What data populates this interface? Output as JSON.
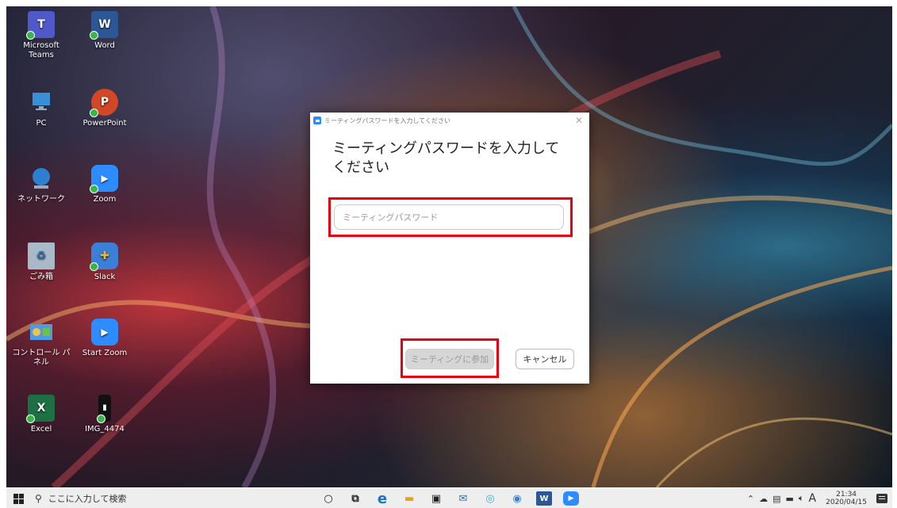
{
  "desktop_icons": [
    {
      "label": "Microsoft Teams",
      "glyph": "T",
      "color": "#5059c9",
      "icon": "teams-icon"
    },
    {
      "label": "Word",
      "glyph": "W",
      "color": "#2b5797",
      "icon": "word-icon"
    },
    {
      "label": "PC",
      "glyph": "",
      "color": "#3a8fd9",
      "icon": "pc-icon"
    },
    {
      "label": "PowerPoint",
      "glyph": "P",
      "color": "#d24726",
      "icon": "powerpoint-icon"
    },
    {
      "label": "ネットワーク",
      "glyph": "",
      "color": "#2f7fd1",
      "icon": "network-icon"
    },
    {
      "label": "Zoom",
      "glyph": "▶",
      "color": "#2d8cff",
      "icon": "zoom-icon"
    },
    {
      "label": "ごみ箱",
      "glyph": "♻",
      "color": "#a8b9c7",
      "icon": "recycle-bin-icon"
    },
    {
      "label": "Slack",
      "glyph": "✚",
      "color": "#3b7fd6",
      "icon": "slack-icon"
    },
    {
      "label": "コントロール パネル",
      "glyph": "",
      "color": "#4d9be6",
      "icon": "control-panel-icon"
    },
    {
      "label": "Start Zoom",
      "glyph": "▶",
      "color": "#2d8cff",
      "icon": "start-zoom-icon"
    },
    {
      "label": "Excel",
      "glyph": "X",
      "color": "#1d7044",
      "icon": "excel-icon"
    },
    {
      "label": "IMG_4474",
      "glyph": "▮",
      "color": "#111111",
      "icon": "image-file-icon"
    }
  ],
  "dialog": {
    "window_title": "ミーティングパスワードを入力してください",
    "close_glyph": "✕",
    "heading": "ミーティングパスワードを入力してください",
    "password_placeholder": "ミーティングパスワード",
    "password_value": "",
    "join_label": "ミーティングに参加",
    "cancel_label": "キャンセル"
  },
  "taskbar": {
    "search_placeholder": "ここに入力して検索",
    "time": "21:34",
    "date": "2020/04/15",
    "ime": "A",
    "apps": [
      {
        "glyph": "○",
        "color": "#222222",
        "icon": "cortana-icon"
      },
      {
        "glyph": "⧉",
        "color": "#222222",
        "icon": "task-view-icon"
      },
      {
        "glyph": "e",
        "color": "#1a73c8",
        "icon": "edge-icon"
      },
      {
        "glyph": "▬",
        "color": "#e8a317",
        "icon": "file-explorer-icon"
      },
      {
        "glyph": "▣",
        "color": "#222222",
        "icon": "store-icon"
      },
      {
        "glyph": "✉",
        "color": "#1a73c8",
        "icon": "mail-icon"
      },
      {
        "glyph": "◎",
        "color": "#2bb0e8",
        "icon": "ie-icon"
      },
      {
        "glyph": "◉",
        "color": "#3b7fd6",
        "icon": "settings-app-icon"
      },
      {
        "glyph": "W",
        "color": "#2b5797",
        "icon": "word-taskbar-icon"
      },
      {
        "glyph": "▶",
        "color": "#2d8cff",
        "icon": "zoom-taskbar-icon"
      }
    ]
  },
  "highlight_color": "#e60012"
}
